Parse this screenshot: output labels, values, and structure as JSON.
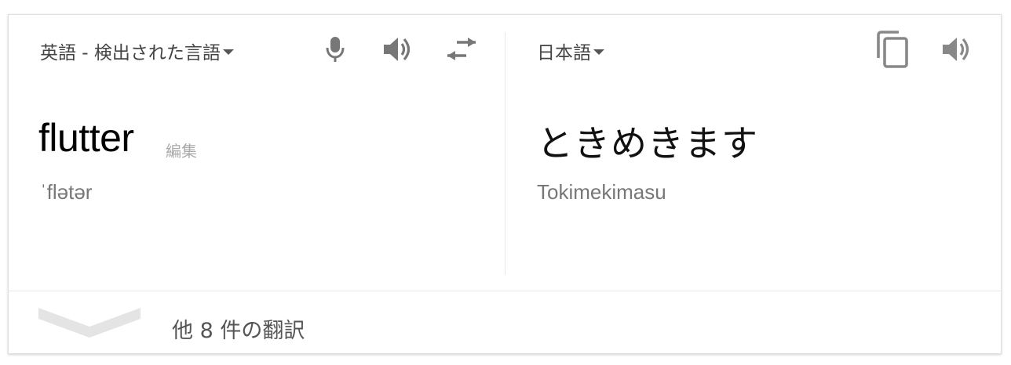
{
  "source": {
    "language_label": "英語 - 検出された言語",
    "text": "flutter",
    "edit_label": "編集",
    "phonetic": "ˈflətər",
    "icons": [
      "microphone-icon",
      "speaker-icon",
      "swap-icon"
    ]
  },
  "target": {
    "language_label": "日本語",
    "text": "ときめきます",
    "romanization": "Tokimekimasu",
    "icons": [
      "copy-icon",
      "speaker-icon"
    ]
  },
  "footer": {
    "more_label": "他 8 件の翻訳",
    "icon": "chevron-down-icon"
  },
  "colors": {
    "icon": "#777777",
    "divider": "#e6e6e6",
    "chevron": "#e0e0e0"
  }
}
